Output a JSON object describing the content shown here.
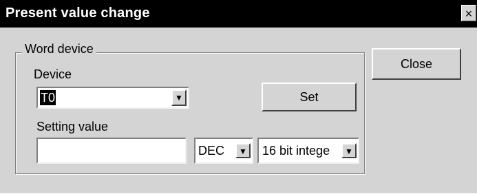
{
  "dialog": {
    "title": "Present value change",
    "close_glyph": "×",
    "close_button_label": "Close"
  },
  "word_device": {
    "group_label": "Word device",
    "device_label": "Device",
    "device_value": "T0",
    "set_button_label": "Set",
    "setting_value_label": "Setting value",
    "setting_value": "",
    "format_value": "DEC",
    "type_value": "16 bit intege"
  },
  "icons": {
    "dropdown_arrow": "▼"
  }
}
